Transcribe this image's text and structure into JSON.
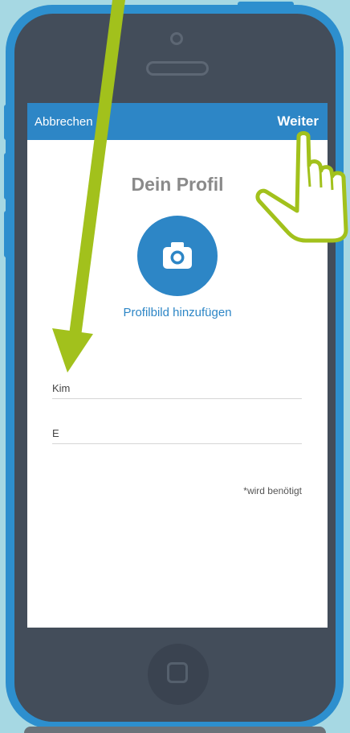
{
  "navbar": {
    "cancel_label": "Abbrechen",
    "next_label": "Weiter"
  },
  "profile": {
    "title": "Dein Profil",
    "avatar_label": "Profilbild hinzufügen",
    "camera_icon": "camera-icon"
  },
  "form": {
    "first_name_value": "Kim",
    "last_name_value": "E",
    "required_note": "*wird benötigt"
  },
  "device": {
    "home_icon": "home-square-icon"
  },
  "colors": {
    "background": "#a6d8e3",
    "phone_shell": "#2d8fce",
    "phone_body": "#434d5a",
    "accent": "#2d86c6",
    "arrow": "#a2c11c"
  }
}
